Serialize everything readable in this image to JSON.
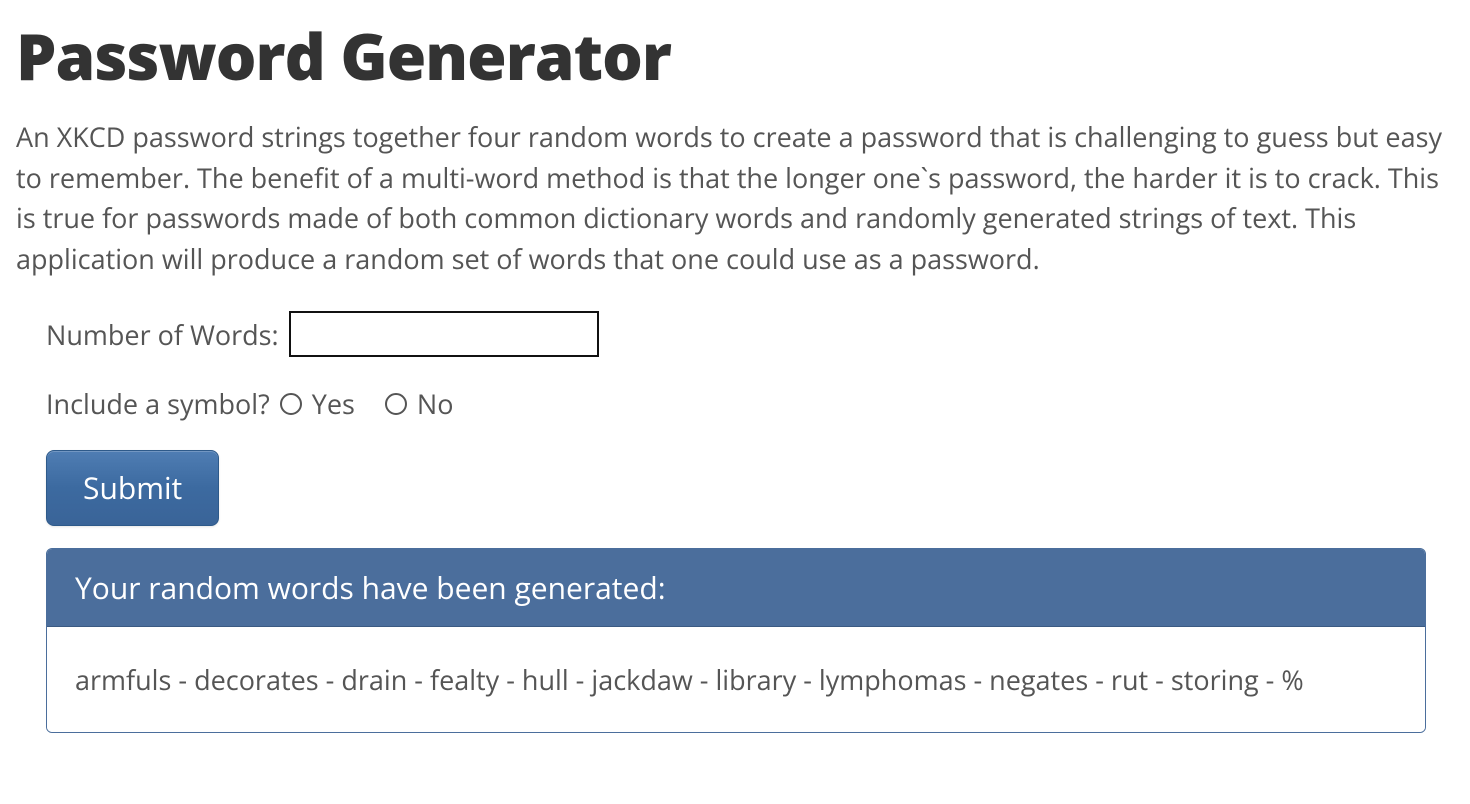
{
  "title": "Password Generator",
  "intro": "An XKCD password strings together four random words to create a password that is challenging to guess but easy to remember. The benefit of a multi-word method is that the longer one`s password, the harder it is to crack. This is true for passwords made of both common dictionary words and randomly generated strings of text. This application will produce a random set of words that one could use as a password.",
  "form": {
    "numWordsLabel": "Number of Words:",
    "numWordsValue": "",
    "symbolLabel": "Include a symbol?",
    "yesLabel": "Yes",
    "noLabel": "No",
    "submitLabel": "Submit"
  },
  "result": {
    "heading": "Your random words have been generated:",
    "password": "armfuls - decorates - drain - fealty - hull - jackdaw - library - lymphomas - negates - rut - storing - %"
  }
}
